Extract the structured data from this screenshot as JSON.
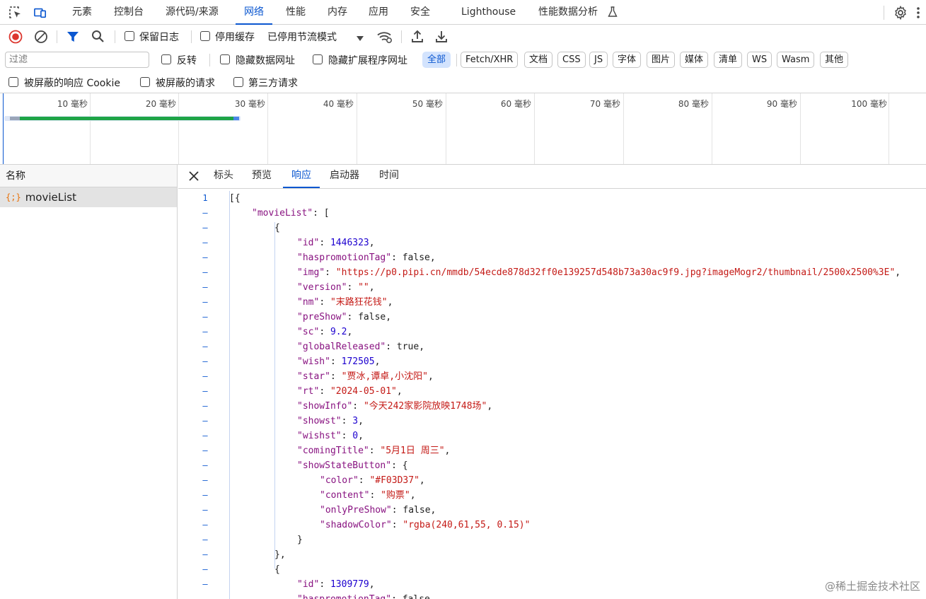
{
  "main_tabs": [
    {
      "label": "元素"
    },
    {
      "label": "控制台"
    },
    {
      "label": "源代码/来源"
    },
    {
      "label": "网络"
    },
    {
      "label": "性能"
    },
    {
      "label": "内存"
    },
    {
      "label": "应用"
    },
    {
      "label": "安全"
    },
    {
      "label": "Lighthouse"
    },
    {
      "label": "性能数据分析"
    }
  ],
  "toolbar": {
    "preserve_log": "保留日志",
    "disable_cache": "停用缓存",
    "throttle": "已停用节流模式"
  },
  "filter": {
    "placeholder": "过滤",
    "invert": "反转",
    "hide_data_urls": "隐藏数据网址",
    "hide_ext_urls": "隐藏扩展程序网址",
    "types": [
      "全部",
      "Fetch/XHR",
      "文档",
      "CSS",
      "JS",
      "字体",
      "图片",
      "媒体",
      "清单",
      "WS",
      "Wasm",
      "其他"
    ],
    "blocked_cookies": "被屏蔽的响应 Cookie",
    "blocked_requests": "被屏蔽的请求",
    "third_party": "第三方请求"
  },
  "timeline": {
    "ticks": [
      "10 毫秒",
      "20 毫秒",
      "30 毫秒",
      "40 毫秒",
      "50 毫秒",
      "60 毫秒",
      "70 毫秒",
      "80 毫秒",
      "90 毫秒",
      "100 毫秒"
    ]
  },
  "requests": {
    "header": "名称",
    "items": [
      {
        "name": "movieList"
      }
    ]
  },
  "detail_tabs": [
    "标头",
    "预览",
    "响应",
    "启动器",
    "时间"
  ],
  "code_lines": [
    {
      "ln": "1",
      "indent": 0,
      "text": "[{"
    },
    {
      "ln": "–",
      "indent": 1,
      "key": "movieList",
      "rest": ": ["
    },
    {
      "ln": "–",
      "indent": 2,
      "text": "{"
    },
    {
      "ln": "–",
      "indent": 3,
      "key": "id",
      "num": "1446323"
    },
    {
      "ln": "–",
      "indent": 3,
      "key": "haspromotionTag",
      "lit": "false"
    },
    {
      "ln": "–",
      "indent": 3,
      "key": "img",
      "str": "https://p0.pipi.cn/mmdb/54ecde878d32ff0e139257d548b73a30ac9f9.jpg?imageMogr2/thumbnail/2500x2500%3E"
    },
    {
      "ln": "–",
      "indent": 3,
      "key": "version",
      "str": ""
    },
    {
      "ln": "–",
      "indent": 3,
      "key": "nm",
      "str": "末路狂花钱"
    },
    {
      "ln": "–",
      "indent": 3,
      "key": "preShow",
      "lit": "false"
    },
    {
      "ln": "–",
      "indent": 3,
      "key": "sc",
      "num": "9.2"
    },
    {
      "ln": "–",
      "indent": 3,
      "key": "globalReleased",
      "lit": "true"
    },
    {
      "ln": "–",
      "indent": 3,
      "key": "wish",
      "num": "172505"
    },
    {
      "ln": "–",
      "indent": 3,
      "key": "star",
      "str": "贾冰,谭卓,小沈阳"
    },
    {
      "ln": "–",
      "indent": 3,
      "key": "rt",
      "str": "2024-05-01"
    },
    {
      "ln": "–",
      "indent": 3,
      "key": "showInfo",
      "str": "今天242家影院放映1748场"
    },
    {
      "ln": "–",
      "indent": 3,
      "key": "showst",
      "num": "3"
    },
    {
      "ln": "–",
      "indent": 3,
      "key": "wishst",
      "num": "0"
    },
    {
      "ln": "–",
      "indent": 3,
      "key": "comingTitle",
      "str": "5月1日 周三"
    },
    {
      "ln": "–",
      "indent": 3,
      "key": "showStateButton",
      "rest": ": {"
    },
    {
      "ln": "–",
      "indent": 4,
      "key": "color",
      "str": "#F03D37"
    },
    {
      "ln": "–",
      "indent": 4,
      "key": "content",
      "str": "购票"
    },
    {
      "ln": "–",
      "indent": 4,
      "key": "onlyPreShow",
      "lit": "false"
    },
    {
      "ln": "–",
      "indent": 4,
      "key": "shadowColor",
      "str": "rgba(240,61,55, 0.15)",
      "last": true
    },
    {
      "ln": "–",
      "indent": 3,
      "text": "}"
    },
    {
      "ln": "–",
      "indent": 2,
      "text": "},"
    },
    {
      "ln": "–",
      "indent": 2,
      "text": "{"
    },
    {
      "ln": "–",
      "indent": 3,
      "key": "id",
      "num": "1309779"
    },
    {
      "ln": "–",
      "indent": 3,
      "key": "haspromotionTag",
      "lit": "false"
    }
  ],
  "watermark": "@稀土掘金技术社区",
  "colors": {
    "accent": "#0b57d0",
    "record": "#dc362e",
    "waterfall": "#1ea446"
  }
}
